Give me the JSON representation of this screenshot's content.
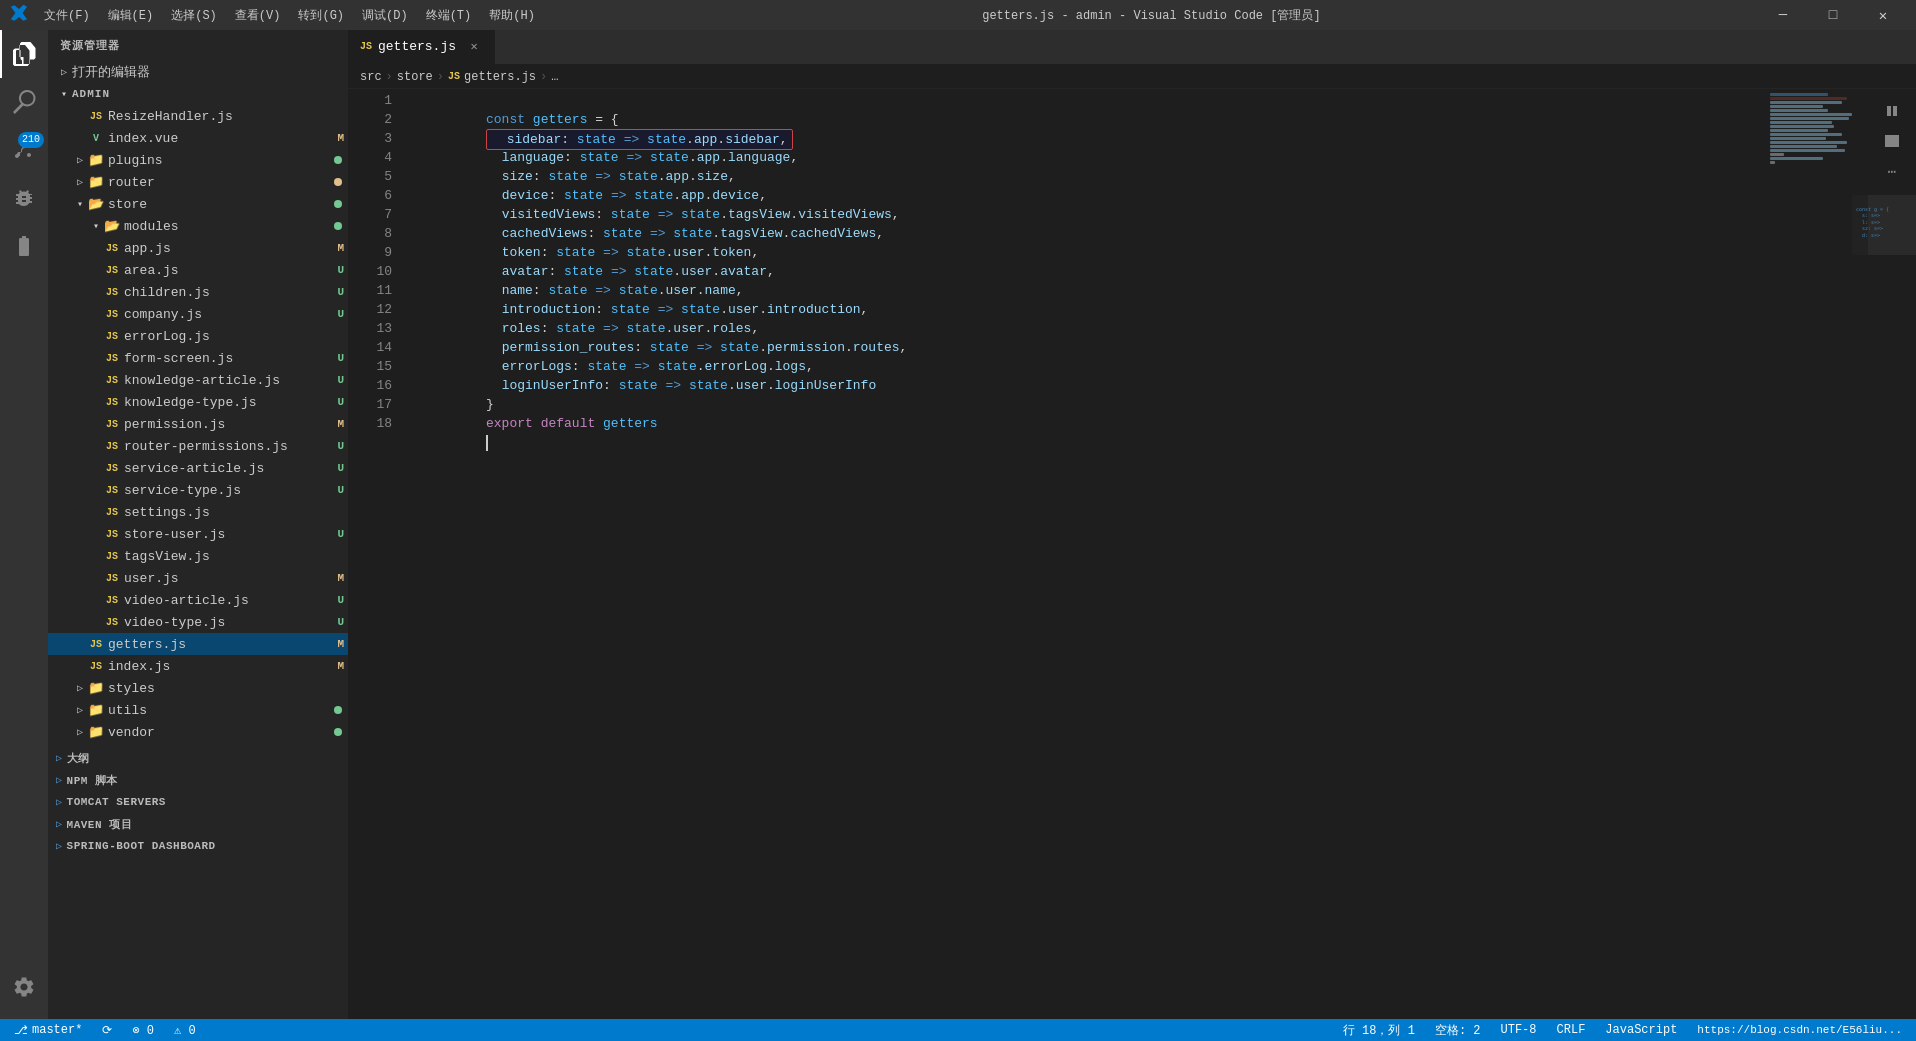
{
  "titleBar": {
    "logo": "VS",
    "menus": [
      "文件(F)",
      "编辑(E)",
      "选择(S)",
      "查看(V)",
      "转到(G)",
      "调试(D)",
      "终端(T)",
      "帮助(H)"
    ],
    "title": "getters.js - admin - Visual Studio Code [管理员]",
    "buttons": [
      "─",
      "□",
      "✕"
    ]
  },
  "activityBar": {
    "icons": [
      "explorer",
      "search",
      "source-control",
      "debug",
      "extensions",
      "settings"
    ],
    "badge": "210"
  },
  "sidebar": {
    "title": "资源管理器",
    "openEditors": "打开的编辑器",
    "rootFolder": "ADMIN",
    "items": [
      {
        "label": "ResizeHandler.js",
        "type": "file",
        "icon": "js",
        "indent": 2,
        "badge": ""
      },
      {
        "label": "index.vue",
        "type": "file",
        "icon": "vue",
        "indent": 2,
        "badge": "M"
      },
      {
        "label": "plugins",
        "type": "folder",
        "indent": 1,
        "dot": "green"
      },
      {
        "label": "router",
        "type": "folder",
        "indent": 1,
        "dot": "orange"
      },
      {
        "label": "store",
        "type": "folder-open",
        "indent": 1,
        "dot": "green"
      },
      {
        "label": "modules",
        "type": "folder-open",
        "indent": 2,
        "dot": "green"
      },
      {
        "label": "app.js",
        "type": "file",
        "icon": "js",
        "indent": 3,
        "badge": "M"
      },
      {
        "label": "area.js",
        "type": "file",
        "icon": "js",
        "indent": 3,
        "badge": "U"
      },
      {
        "label": "children.js",
        "type": "file",
        "icon": "js",
        "indent": 3,
        "badge": "U"
      },
      {
        "label": "company.js",
        "type": "file",
        "icon": "js",
        "indent": 3,
        "badge": "U"
      },
      {
        "label": "errorLog.js",
        "type": "file",
        "icon": "js",
        "indent": 3,
        "badge": ""
      },
      {
        "label": "form-screen.js",
        "type": "file",
        "icon": "js",
        "indent": 3,
        "badge": "U"
      },
      {
        "label": "knowledge-article.js",
        "type": "file",
        "icon": "js",
        "indent": 3,
        "badge": "U"
      },
      {
        "label": "knowledge-type.js",
        "type": "file",
        "icon": "js",
        "indent": 3,
        "badge": "U"
      },
      {
        "label": "permission.js",
        "type": "file",
        "icon": "js",
        "indent": 3,
        "badge": "M"
      },
      {
        "label": "router-permissions.js",
        "type": "file",
        "icon": "js",
        "indent": 3,
        "badge": "U"
      },
      {
        "label": "service-article.js",
        "type": "file",
        "icon": "js",
        "indent": 3,
        "badge": "U"
      },
      {
        "label": "service-type.js",
        "type": "file",
        "icon": "js",
        "indent": 3,
        "badge": "U"
      },
      {
        "label": "settings.js",
        "type": "file",
        "icon": "js",
        "indent": 3,
        "badge": ""
      },
      {
        "label": "store-user.js",
        "type": "file",
        "icon": "js",
        "indent": 3,
        "badge": "U"
      },
      {
        "label": "tagsView.js",
        "type": "file",
        "icon": "js",
        "indent": 3,
        "badge": ""
      },
      {
        "label": "user.js",
        "type": "file",
        "icon": "js",
        "indent": 3,
        "badge": "M"
      },
      {
        "label": "video-article.js",
        "type": "file",
        "icon": "js",
        "indent": 3,
        "badge": "U"
      },
      {
        "label": "video-type.js",
        "type": "file",
        "icon": "js",
        "indent": 3,
        "badge": "U"
      },
      {
        "label": "getters.js",
        "type": "file",
        "icon": "js",
        "indent": 2,
        "badge": "M",
        "active": true
      },
      {
        "label": "index.js",
        "type": "file",
        "icon": "js",
        "indent": 2,
        "badge": "M"
      },
      {
        "label": "styles",
        "type": "folder",
        "indent": 1
      },
      {
        "label": "utils",
        "type": "folder",
        "indent": 1,
        "dot": "green"
      },
      {
        "label": "vendor",
        "type": "folder",
        "indent": 1,
        "dot": "green"
      }
    ],
    "bottomSections": [
      {
        "label": "大纲",
        "collapsed": true
      },
      {
        "label": "NPM 脚本",
        "collapsed": true
      },
      {
        "label": "TOMCAT SERVERS",
        "collapsed": true
      },
      {
        "label": "MAVEN 项目",
        "collapsed": true
      },
      {
        "label": "SPRING-BOOT DASHBOARD",
        "collapsed": true
      }
    ]
  },
  "tab": {
    "filename": "getters.js",
    "icon": "JS"
  },
  "breadcrumb": {
    "parts": [
      "src",
      "store",
      "getters.js",
      "…"
    ]
  },
  "code": {
    "lines": [
      {
        "num": 1,
        "text": "const getters = {"
      },
      {
        "num": 2,
        "text": "  sidebar: state => state.app.sidebar,",
        "highlight": true
      },
      {
        "num": 3,
        "text": "  language: state => state.app.language,"
      },
      {
        "num": 4,
        "text": "  size: state => state.app.size,"
      },
      {
        "num": 5,
        "text": "  device: state => state.app.device,"
      },
      {
        "num": 6,
        "text": "  visitedViews: state => state.tagsView.visitedViews,"
      },
      {
        "num": 7,
        "text": "  cachedViews: state => state.tagsView.cachedViews,"
      },
      {
        "num": 8,
        "text": "  token: state => state.user.token,"
      },
      {
        "num": 9,
        "text": "  avatar: state => state.user.avatar,"
      },
      {
        "num": 10,
        "text": "  name: state => state.user.name,"
      },
      {
        "num": 11,
        "text": "  introduction: state => state.user.introduction,"
      },
      {
        "num": 12,
        "text": "  roles: state => state.user.roles,"
      },
      {
        "num": 13,
        "text": "  permission_routes: state => state.permission.routes,"
      },
      {
        "num": 14,
        "text": "  errorLogs: state => state.errorLog.logs,"
      },
      {
        "num": 15,
        "text": "  loginUserInfo: state => state.user.loginUserInfo"
      },
      {
        "num": 16,
        "text": "}"
      },
      {
        "num": 17,
        "text": "export default getters"
      },
      {
        "num": 18,
        "text": ""
      }
    ]
  },
  "statusBar": {
    "branch": "master*",
    "sync": "⟳",
    "errors": "⊗ 0",
    "warnings": "⚠ 0",
    "position": "行 18，列 1",
    "spaces": "空格: 2",
    "encoding": "UTF-8",
    "lineEnding": "CRLF",
    "language": "JavaScript",
    "link": "https://blog.csdn.net/E56liu..."
  }
}
